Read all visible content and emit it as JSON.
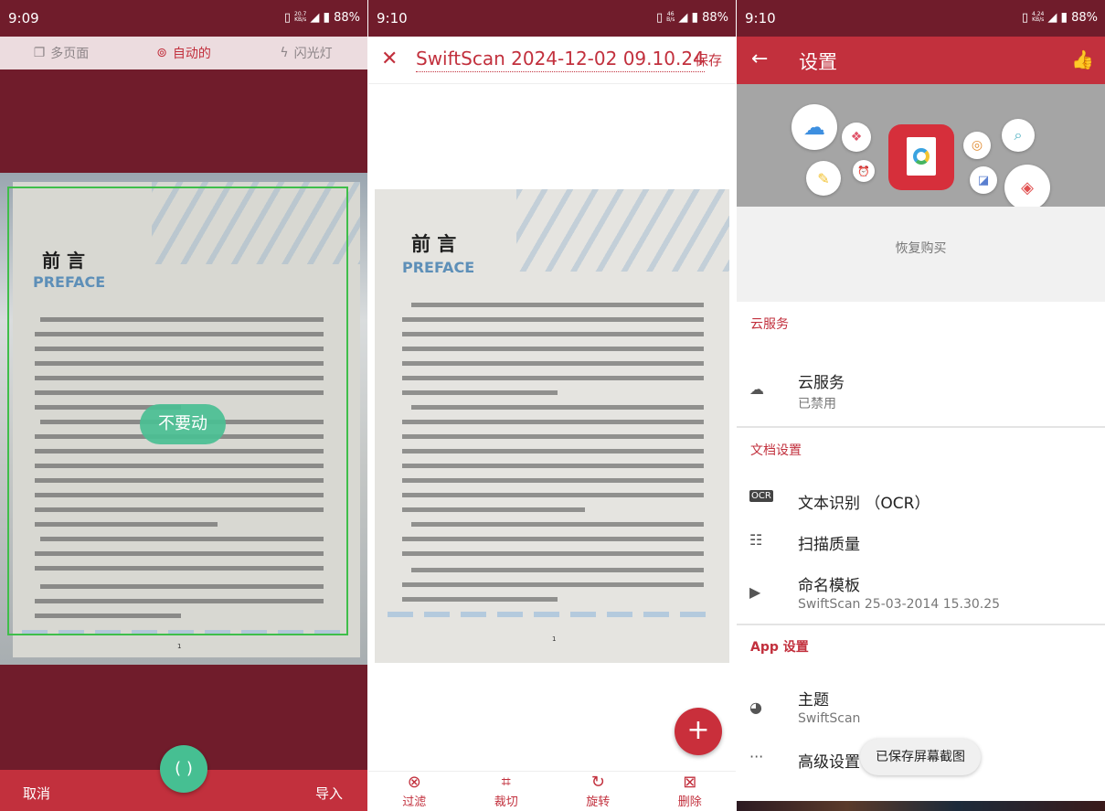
{
  "colors": {
    "brand_dark": "#701c2b",
    "brand": "#c2303d",
    "accent_green": "#46bf92"
  },
  "screens": [
    {
      "status": {
        "time": "9:09",
        "speed_top": "20.7",
        "speed_unit": "KB/s",
        "battery": "88%"
      },
      "modes": [
        {
          "icon": "pages-icon",
          "label": "多页面"
        },
        {
          "icon": "auto-icon",
          "label": "自动的"
        },
        {
          "icon": "flash-icon",
          "label": "闪光灯"
        }
      ],
      "hint": "不要动",
      "cancel": "取消",
      "import": "导入"
    },
    {
      "status": {
        "time": "9:10",
        "speed_top": "46",
        "speed_unit": "B/s",
        "battery": "88%"
      },
      "title": "SwiftScan 2024-12-02 09.10.24",
      "save": "保存",
      "tools": [
        {
          "icon": "filter-icon",
          "label": "过滤"
        },
        {
          "icon": "crop-icon",
          "label": "裁切"
        },
        {
          "icon": "rotate-icon",
          "label": "旋转"
        },
        {
          "icon": "delete-icon",
          "label": "删除"
        }
      ]
    },
    {
      "status": {
        "time": "9:10",
        "speed_top": "4.24",
        "speed_unit": "KB/s",
        "battery": "88%"
      },
      "title": "设置",
      "restore": "恢复购买",
      "sections": {
        "cloud": "云服务",
        "document": "文档设置",
        "app": "App 设置"
      },
      "items": {
        "cloud_label": "云服务",
        "cloud_value": "已禁用",
        "ocr_label": "文本识别 （OCR）",
        "quality_label": "扫描质量",
        "naming_label": "命名模板",
        "naming_value": "SwiftScan 25-03-2014 15.30.25",
        "theme_label": "主题",
        "theme_value": "SwiftScan",
        "advanced_label": "高级设置"
      },
      "toast": "已保存屏幕截图"
    }
  ],
  "document": {
    "heading": "前 言",
    "subheading": "PREFACE",
    "page_number": "1"
  }
}
